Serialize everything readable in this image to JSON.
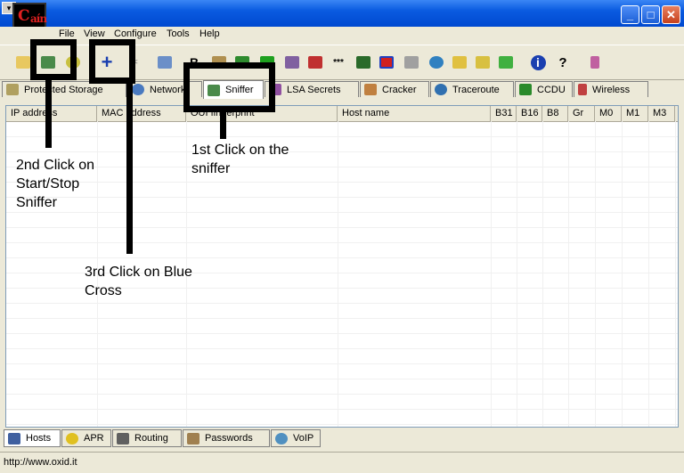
{
  "window": {
    "logo_text": "C",
    "logo_sub": "aín",
    "controls": [
      "_",
      "□",
      "✕"
    ]
  },
  "menu": [
    "File",
    "View",
    "Configure",
    "Tools",
    "Help"
  ],
  "top_tabs": [
    {
      "label": "Protected Storage",
      "icon": "protected-storage-icon"
    },
    {
      "label": "Network",
      "icon": "network-icon"
    },
    {
      "label": "Sniffer",
      "icon": "sniffer-icon"
    },
    {
      "label": "LSA Secrets",
      "icon": "lsa-secrets-icon"
    },
    {
      "label": "Cracker",
      "icon": "cracker-icon"
    },
    {
      "label": "Traceroute",
      "icon": "traceroute-icon"
    },
    {
      "label": "CCDU",
      "icon": "ccdu-icon"
    },
    {
      "label": "Wireless",
      "icon": "wireless-icon"
    }
  ],
  "columns": [
    "IP address",
    "MAC address",
    "OUI fingerprint",
    "Host name",
    "B31",
    "B16",
    "B8",
    "Gr",
    "M0",
    "M1",
    "M3"
  ],
  "bottom_tabs": [
    {
      "label": "Hosts",
      "icon": "hosts-icon"
    },
    {
      "label": "APR",
      "icon": "apr-icon"
    },
    {
      "label": "Routing",
      "icon": "routing-icon"
    },
    {
      "label": "Passwords",
      "icon": "passwords-icon"
    },
    {
      "label": "VoIP",
      "icon": "voip-icon"
    }
  ],
  "status_text": "http://www.oxid.it",
  "annotations": {
    "first": "1st Click on the sniffer",
    "second": "2nd Click on Start/Stop Sniffer",
    "third": "3rd Click on Blue Cross"
  },
  "colors": {
    "title_bar": "#0a5be0",
    "blue_cross": "#1a3fb0",
    "logo_red": "#e02020"
  }
}
